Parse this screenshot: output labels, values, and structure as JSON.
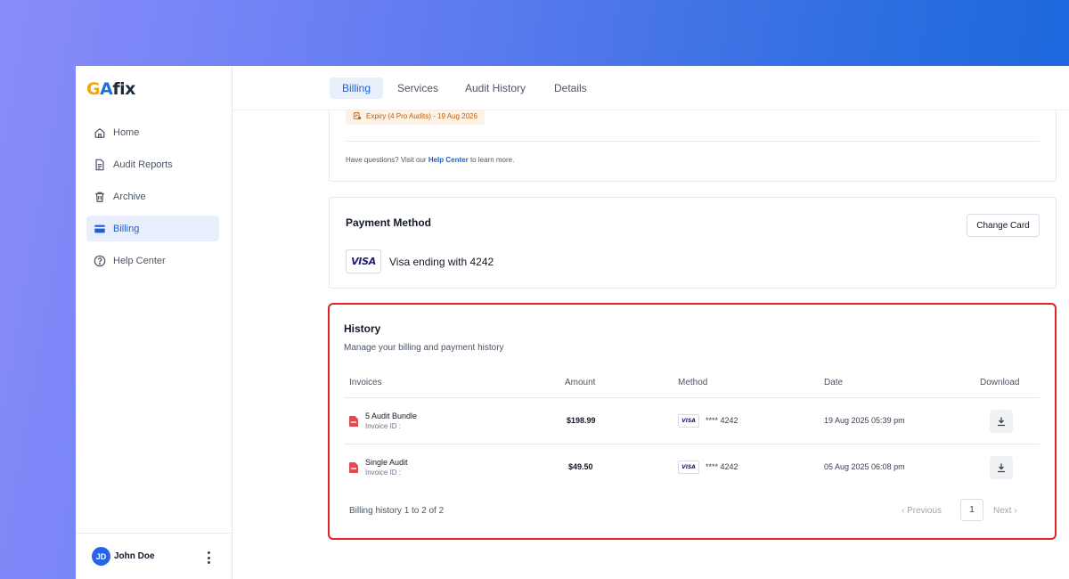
{
  "brand": {
    "logo_g": "G",
    "logo_a": "A",
    "logo_fix": "fix"
  },
  "sidebar": {
    "items": [
      {
        "label": "Home",
        "icon": "home-icon"
      },
      {
        "label": "Audit Reports",
        "icon": "document-icon"
      },
      {
        "label": "Archive",
        "icon": "trash-icon"
      },
      {
        "label": "Billing",
        "icon": "credit-card-icon",
        "active": true
      },
      {
        "label": "Help Center",
        "icon": "help-circle-icon"
      }
    ],
    "user": {
      "initials": "JD",
      "name": "John Doe"
    }
  },
  "tabs": [
    {
      "label": "Billing",
      "active": true
    },
    {
      "label": "Services"
    },
    {
      "label": "Audit History"
    },
    {
      "label": "Details"
    }
  ],
  "plan": {
    "expiry": "Expiry (4 Pro Audits) - 19 Aug 2026",
    "help_prefix": "Have questions? Visit our",
    "help_link": "Help Center",
    "help_suffix": "to learn more."
  },
  "payment": {
    "title": "Payment Method",
    "change_label": "Change Card",
    "card_brand": "VISA",
    "card_label": "Visa ending with 4242"
  },
  "history": {
    "title": "History",
    "subtitle": "Manage your billing and payment history",
    "columns": [
      "Invoices",
      "Amount",
      "Method",
      "Date",
      "Download"
    ],
    "rows": [
      {
        "name": "5 Audit Bundle",
        "invoice_id": "Invoice ID :",
        "amount": "$198.99",
        "card_brand": "VISA",
        "card": "**** 4242",
        "date": "19 Aug 2025 05:39 pm"
      },
      {
        "name": "Single Audit",
        "invoice_id": "Invoice ID :",
        "amount": "$49.50",
        "card_brand": "VISA",
        "card": "**** 4242",
        "date": "05 Aug 2025 06:08 pm"
      }
    ],
    "pager_text": "Billing history 1 to 2 of 2",
    "prev_label": "‹  Previous",
    "page": "1",
    "next_label": "Next  ›"
  },
  "colors": {
    "accent": "#1f5fd1",
    "highlight": "#e02424",
    "expiry": "#c2610c"
  }
}
